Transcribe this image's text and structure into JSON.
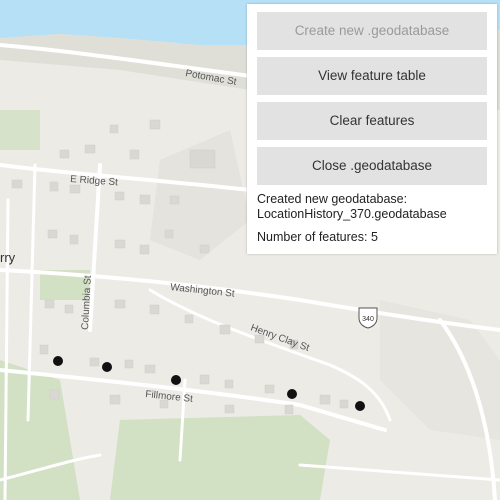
{
  "panel": {
    "buttons": [
      {
        "label": "Create new .geodatabase",
        "enabled": false
      },
      {
        "label": "View feature table",
        "enabled": true
      },
      {
        "label": "Clear features",
        "enabled": true
      },
      {
        "label": "Close .geodatabase",
        "enabled": true
      }
    ],
    "status_line1": "Created new geodatabase:",
    "status_line2": "LocationHistory_370.geodatabase",
    "feature_count_label": "Number of features: 5"
  },
  "map": {
    "streets": {
      "potomac": "Potomac St",
      "ridge": "E Ridge St",
      "washington": "Washington St",
      "henry_clay": "Henry Clay St",
      "columbia": "Columbia St",
      "fillmore": "Fillmore St"
    },
    "place_label": "rry",
    "route_shield": "340",
    "feature_points_count": 5
  },
  "colors": {
    "water": "#b6e0f5",
    "land": "#ecebe6",
    "park": "#d2e0c4",
    "road": "#ffffff",
    "building": "#d9d8d2",
    "feature_point": "#111111"
  }
}
